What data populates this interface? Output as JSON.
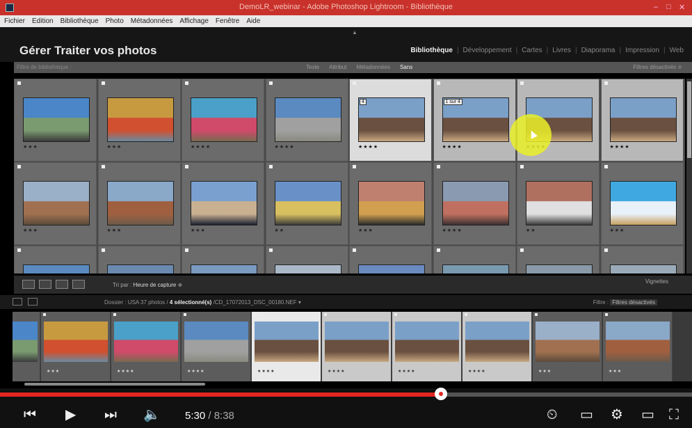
{
  "window": {
    "title": "DemoLR_webinar - Adobe Photoshop Lightroom - Bibliothèque",
    "minimize": "–",
    "maximize": "□",
    "close": "✕"
  },
  "menubar": [
    "Fichier",
    "Edition",
    "Bibliothèque",
    "Photo",
    "Métadonnées",
    "Affichage",
    "Fenêtre",
    "Aide"
  ],
  "header": {
    "brand": "Gérer Traiter vos photos",
    "modules": [
      {
        "label": "Bibliothèque",
        "active": true
      },
      {
        "label": "Développement",
        "active": false
      },
      {
        "label": "Cartes",
        "active": false
      },
      {
        "label": "Livres",
        "active": false
      },
      {
        "label": "Diaporama",
        "active": false
      },
      {
        "label": "Impression",
        "active": false
      },
      {
        "label": "Web",
        "active": false
      }
    ]
  },
  "filter_bar": {
    "placeholder": "Filtre de bibliothèque :",
    "options": [
      "Texte",
      "Attribut",
      "Métadonnées",
      "Sans"
    ],
    "active": "Sans",
    "preset": "Filtres désactivés ≑"
  },
  "grid": {
    "rows": [
      [
        {
          "stars": "★★★",
          "state": "normal",
          "colors": [
            "#4a86c8",
            "#7a9a70",
            "#3a3a3a"
          ]
        },
        {
          "stars": "★★★",
          "state": "normal",
          "colors": [
            "#c89a40",
            "#d05030",
            "#6a8aa0"
          ]
        },
        {
          "stars": "★★★★",
          "state": "normal",
          "colors": [
            "#4aa0c8",
            "#d04a6a",
            "#7a6a50"
          ]
        },
        {
          "stars": "★★★★",
          "state": "normal",
          "colors": [
            "#5a8ac0",
            "#a0a0a0",
            "#8a8a80"
          ]
        },
        {
          "stars": "★★★★",
          "state": "primary",
          "badge": "4",
          "colors": [
            "#7aa0c8",
            "#6a5040",
            "#c8a880"
          ]
        },
        {
          "stars": "★★★★",
          "state": "sel",
          "badge": "1 sur 4",
          "colors": [
            "#7aa0c8",
            "#6a5040",
            "#c8a880"
          ]
        },
        {
          "stars": "★★★★",
          "state": "sel",
          "colors": [
            "#7aa0c8",
            "#6a5040",
            "#c8a880"
          ]
        },
        {
          "stars": "★★★★",
          "state": "sel",
          "colors": [
            "#7aa0c8",
            "#6a5040",
            "#c8a880"
          ]
        }
      ],
      [
        {
          "stars": "★★★",
          "state": "normal",
          "colors": [
            "#9ab0c8",
            "#a07050",
            "#5a4a3a"
          ]
        },
        {
          "stars": "★★★",
          "state": "normal",
          "colors": [
            "#8aa8c8",
            "#a06040",
            "#6a5a4a"
          ]
        },
        {
          "stars": "★★★",
          "state": "normal",
          "colors": [
            "#7aa0d0",
            "#c8b090",
            "#1a2030"
          ]
        },
        {
          "stars": "★★",
          "state": "normal",
          "colors": [
            "#6a90c8",
            "#d8c060",
            "#3a3a3a"
          ]
        },
        {
          "stars": "★★★",
          "state": "normal",
          "colors": [
            "#c08070",
            "#d0a050",
            "#2a2a2a"
          ]
        },
        {
          "stars": "★★★★",
          "state": "normal",
          "colors": [
            "#8a9ab0",
            "#c07060",
            "#3a3030"
          ]
        },
        {
          "stars": "★★",
          "state": "normal",
          "colors": [
            "#b07060",
            "#e0e0e0",
            "#3a3a3a"
          ]
        },
        {
          "stars": "★★★",
          "state": "normal",
          "colors": [
            "#40a8e0",
            "#e8f0f8",
            "#c8a060"
          ]
        }
      ],
      [
        {
          "stars": "",
          "state": "normal",
          "colors": [
            "#5a8ac0",
            "#7a7a7a",
            "#4a4a4a"
          ]
        },
        {
          "stars": "",
          "state": "normal",
          "colors": [
            "#6a8ab0",
            "#8a8a8a",
            "#4a4a4a"
          ]
        },
        {
          "stars": "",
          "state": "normal",
          "colors": [
            "#7a9ac0",
            "#8a7a6a",
            "#4a4a4a"
          ]
        },
        {
          "stars": "",
          "state": "normal",
          "colors": [
            "#aab8c8",
            "#7a6a5a",
            "#4a4a4a"
          ]
        },
        {
          "stars": "",
          "state": "normal",
          "colors": [
            "#6a8ac0",
            "#9a8a7a",
            "#4a4a4a"
          ]
        },
        {
          "stars": "",
          "state": "normal",
          "colors": [
            "#7a9ab0",
            "#8a8070",
            "#4a4a4a"
          ]
        },
        {
          "stars": "",
          "state": "normal",
          "colors": [
            "#8a9aa8",
            "#9a8a80",
            "#4a4a4a"
          ]
        },
        {
          "stars": "",
          "state": "normal",
          "colors": [
            "#9aaab8",
            "#8a8a8a",
            "#4a4a4a"
          ]
        }
      ]
    ]
  },
  "toolbar": {
    "sort_label": "Tri par :",
    "sort_value": "Heure de capture ≑",
    "thumbnails_label": "Vignettes"
  },
  "filmhead": {
    "source": "Dossier : USA",
    "count": "37 photos /",
    "selection": "4 sélectionné(s)",
    "file": "/CD_17072013_DSC_00180.NEF ▾",
    "filter_label": "Filtre :",
    "filter_value": "Filtres désactivés"
  },
  "filmstrip": [
    {
      "stars": "",
      "state": "normal",
      "colors": [
        "#4a86c8",
        "#7a9a70",
        "#3a3a3a"
      ]
    },
    {
      "stars": "★★★",
      "state": "normal",
      "colors": [
        "#c89a40",
        "#d05030",
        "#6a8aa0"
      ]
    },
    {
      "stars": "★★★★",
      "state": "normal",
      "colors": [
        "#4aa0c8",
        "#d04a6a",
        "#7a6a50"
      ]
    },
    {
      "stars": "★★★★",
      "state": "normal",
      "colors": [
        "#5a8ac0",
        "#a0a0a0",
        "#8a8a80"
      ]
    },
    {
      "stars": "★★★★",
      "state": "primary",
      "colors": [
        "#7aa0c8",
        "#6a5040",
        "#c8a880"
      ]
    },
    {
      "stars": "★★★★",
      "state": "sel",
      "colors": [
        "#7aa0c8",
        "#6a5040",
        "#c8a880"
      ]
    },
    {
      "stars": "★★★★",
      "state": "sel",
      "colors": [
        "#7aa0c8",
        "#6a5040",
        "#c8a880"
      ]
    },
    {
      "stars": "★★★★",
      "state": "sel",
      "colors": [
        "#7aa0c8",
        "#6a5040",
        "#c8a880"
      ]
    },
    {
      "stars": "★★★",
      "state": "normal",
      "colors": [
        "#9ab0c8",
        "#a07050",
        "#5a4a3a"
      ]
    },
    {
      "stars": "★★★",
      "state": "normal",
      "colors": [
        "#8aa8c8",
        "#a06040",
        "#6a5a4a"
      ]
    }
  ],
  "player": {
    "current_time": "5:30",
    "duration": " / 8:38",
    "progress": 0.637,
    "accent": "#e52521"
  }
}
